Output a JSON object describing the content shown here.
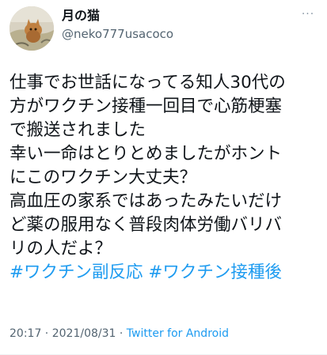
{
  "user": {
    "display_name": "月の猫",
    "handle": "@neko777usacoco",
    "avatar_icon": "avatar-photo-icon"
  },
  "more_icon": "···",
  "tweet": {
    "lines": [
      "仕事でお世話になってる知人30代の",
      "方がワクチン接種一回目で心筋梗塞",
      "で搬送されました",
      "幸い一命はとりとめましたがホント",
      "にこのワクチン大丈夫？",
      "高血圧の家系ではあったみたいだけ",
      "ど薬の服用なく普段肉体労働バリバ",
      "リの人だよ？"
    ],
    "hashtags": [
      "#ワクチン副反応",
      "#ワクチン接種後"
    ]
  },
  "meta": {
    "time": "20:17",
    "separator1": " · ",
    "date": "2021/08/31",
    "separator2": " · ",
    "source": "Twitter for Android"
  },
  "colors": {
    "link": "#1d9bf0",
    "text": "#0f1419",
    "secondary": "#536471"
  }
}
